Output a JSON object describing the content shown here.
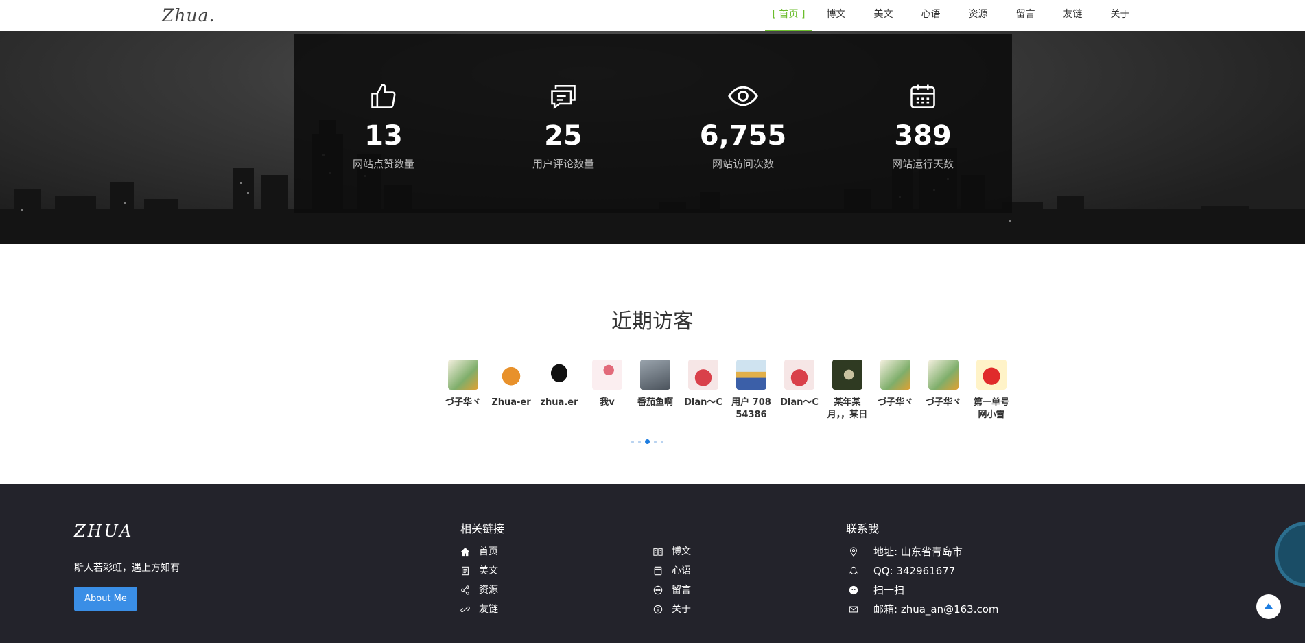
{
  "nav": {
    "logo": "Zhua.",
    "items": [
      {
        "label": "[ 首页 ]",
        "active": true
      },
      {
        "label": "博文"
      },
      {
        "label": "美文"
      },
      {
        "label": "心语"
      },
      {
        "label": "资源"
      },
      {
        "label": "留言"
      },
      {
        "label": "友链"
      },
      {
        "label": "关于"
      }
    ]
  },
  "stats": [
    {
      "icon": "thumbs-up-icon",
      "value": "13",
      "label": "网站点赞数量"
    },
    {
      "icon": "comments-icon",
      "value": "25",
      "label": "用户评论数量"
    },
    {
      "icon": "eye-icon",
      "value": "6,755",
      "label": "网站访问次数"
    },
    {
      "icon": "calendar-icon",
      "value": "389",
      "label": "网站运行天数"
    }
  ],
  "visitors": {
    "title": "近期访客",
    "items": [
      {
        "name": "づ子华ヾ"
      },
      {
        "name": "Zhua-er"
      },
      {
        "name": "zhua.er"
      },
      {
        "name": "我v"
      },
      {
        "name": "番茄鱼啊"
      },
      {
        "name": "Dlan～C"
      },
      {
        "name": "用户 70854386"
      },
      {
        "name": "Dlan～C"
      },
      {
        "name": "某年某月，，某日"
      },
      {
        "name": "づ子华ヾ"
      },
      {
        "name": "づ子华ヾ"
      },
      {
        "name": "第一单号网小雪"
      }
    ]
  },
  "footer": {
    "logo": "ZHUA",
    "motto": "斯人若彩虹，遇上方知有",
    "about_label": "About Me",
    "links_title": "相关链接",
    "links": [
      {
        "label": "首页",
        "icon": "home-icon"
      },
      {
        "label": "博文",
        "icon": "book-icon"
      },
      {
        "label": "美文",
        "icon": "document-icon"
      },
      {
        "label": "心语",
        "icon": "notebook-icon"
      },
      {
        "label": "资源",
        "icon": "share-icon"
      },
      {
        "label": "留言",
        "icon": "chat-icon"
      },
      {
        "label": "友链",
        "icon": "link-icon"
      },
      {
        "label": "关于",
        "icon": "info-icon"
      }
    ],
    "contact_title": "联系我",
    "contacts": [
      {
        "label": "地址: 山东省青岛市",
        "icon": "location-icon"
      },
      {
        "label": "QQ: 342961677",
        "icon": "qq-icon"
      },
      {
        "label": "扫一扫",
        "icon": "wechat-icon"
      },
      {
        "label": "邮箱: zhua_an@163.com",
        "icon": "mail-icon"
      }
    ]
  },
  "colors": {
    "accent_green": "#6bbd2c",
    "button_blue": "#3a8ee6",
    "footer_bg": "#23232b"
  }
}
